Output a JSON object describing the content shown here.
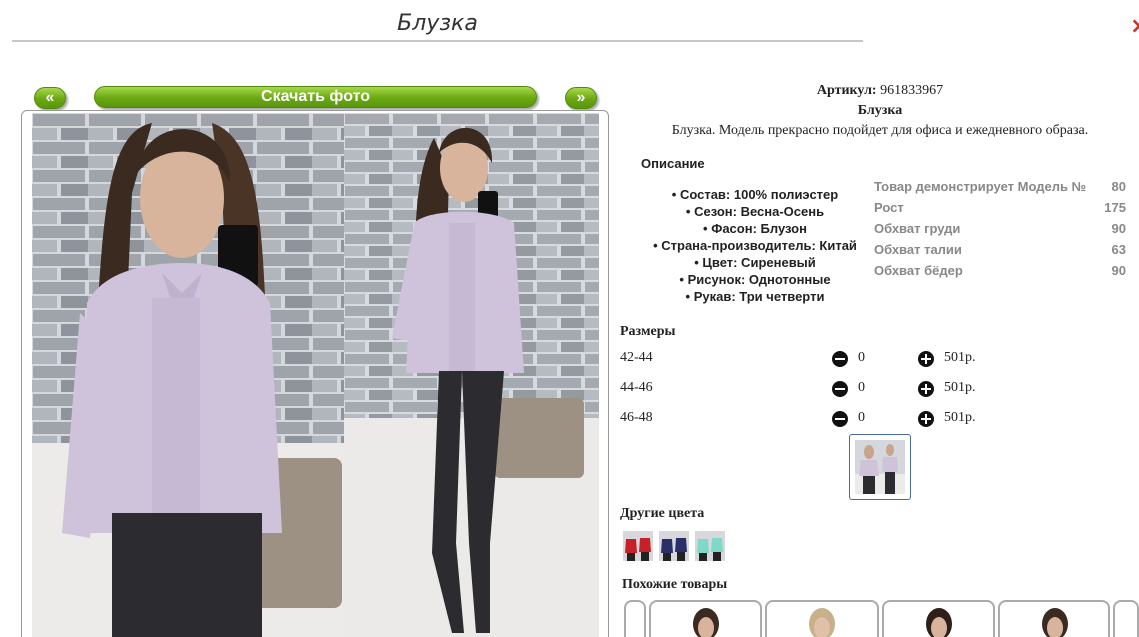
{
  "page": {
    "title": "Блузка",
    "close_glyph": "×"
  },
  "gallery": {
    "prev_label": "«",
    "next_label": "»",
    "download_label": "Скачать фото"
  },
  "product": {
    "article_label": "Артикул:",
    "article_value": "961833967",
    "name": "Блузка",
    "short_description": "Блузка. Модель прекрасно подойдет для офиса и ежедневного образа."
  },
  "description": {
    "title": "Описание",
    "items": [
      "Состав: 100% полиэстер",
      "Сезон: Весна-Осень",
      "Фасон: Блузон",
      "Страна-производитель: Китай",
      "Цвет: Сиреневый",
      "Рисунок: Однотонные",
      "Рукав: Три четверти"
    ]
  },
  "model": {
    "rows": [
      {
        "label": "Товар демонстрирует Модель №",
        "value": "80"
      },
      {
        "label": "Рост",
        "value": "175"
      },
      {
        "label": "Обхват груди",
        "value": "90"
      },
      {
        "label": "Обхват талии",
        "value": "63"
      },
      {
        "label": "Обхват бёдер",
        "value": "90"
      }
    ]
  },
  "sizes": {
    "title": "Размеры",
    "rows": [
      {
        "size": "42-44",
        "qty": "0",
        "price": "501р."
      },
      {
        "size": "44-46",
        "qty": "0",
        "price": "501р."
      },
      {
        "size": "46-48",
        "qty": "0",
        "price": "501р."
      }
    ]
  },
  "other_colors": {
    "title": "Другие цвета",
    "count": 3
  },
  "similar": {
    "title": "Похожие товары"
  },
  "colors": {
    "accent_green": "#6aa813",
    "close_red": "#c8342c",
    "blouse_lilac": "#cfc3dc",
    "brick_gray": "#b9bcc2"
  },
  "icons": [
    "minus-circle-icon",
    "plus-circle-icon"
  ]
}
